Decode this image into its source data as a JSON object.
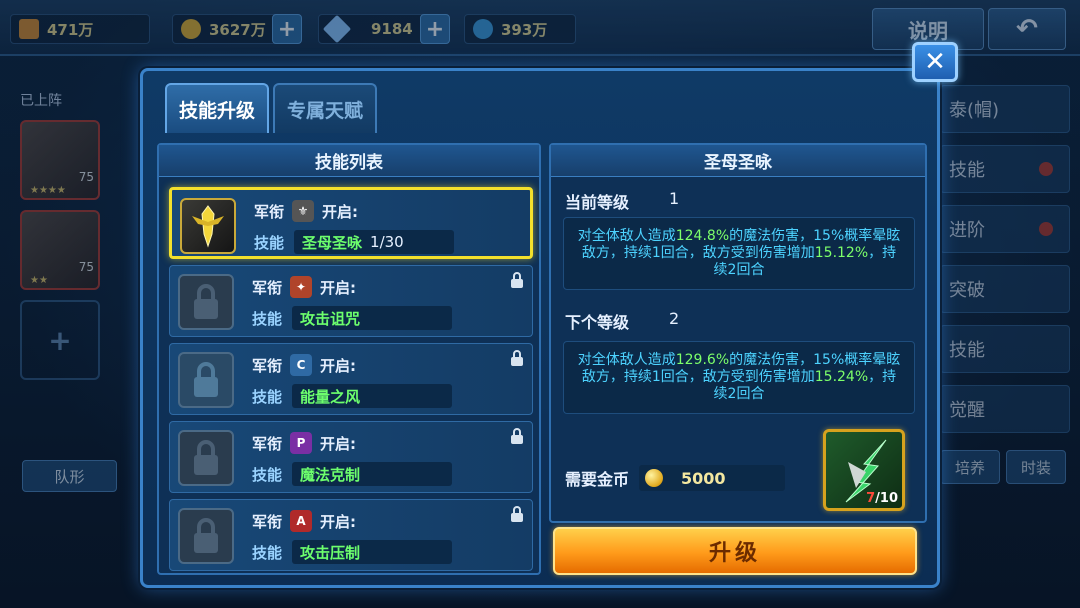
{
  "background": {
    "topbar": {
      "res1_value": "471万",
      "gold_value": "3627万",
      "gem_value": "9184",
      "energy_value": "393万",
      "help_label": "说明"
    },
    "left": {
      "deployed_label": "已上阵",
      "hero1_level": "75",
      "hero2_level": "75",
      "formation_label": "队形"
    },
    "right": {
      "items": [
        "泰(帽)",
        "技能",
        "进阶",
        "突破",
        "技能",
        "觉醒"
      ],
      "bottom": [
        "培养",
        "时装"
      ]
    }
  },
  "dialog": {
    "tabs": [
      {
        "label": "技能升级",
        "active": true
      },
      {
        "label": "专属天赋",
        "active": false
      }
    ],
    "skill_list": {
      "title": "技能列表",
      "rank_label": "军衔",
      "open_label": "开启:",
      "skill_label": "技能",
      "skills": [
        {
          "name": "圣母圣咏",
          "level": "1/30",
          "rank_icon": "wings-badge-icon",
          "rank_color": "#7a7a7a",
          "selected": true,
          "locked": false
        },
        {
          "name": "攻击诅咒",
          "level": "",
          "rank_icon": "star-badge-icon",
          "rank_color": "#b0442a",
          "selected": false,
          "locked": true
        },
        {
          "name": "能量之风",
          "level": "",
          "rank_icon": "c-badge-icon",
          "rank_color": "#2f6aa4",
          "selected": false,
          "locked": true
        },
        {
          "name": "魔法克制",
          "level": "",
          "rank_icon": "p-badge-icon",
          "rank_color": "#7a2fa4",
          "selected": false,
          "locked": true
        },
        {
          "name": "攻击压制",
          "level": "",
          "rank_icon": "a-badge-icon",
          "rank_color": "#b02a2a",
          "selected": false,
          "locked": true
        }
      ]
    },
    "detail": {
      "title": "圣母圣咏",
      "current_level_label": "当前等级",
      "current_level": "1",
      "current_desc_pre": "对全体敌人造成",
      "current_desc_pct": "124.8%",
      "current_desc_mid": "的魔法伤害，15%概率晕眩敌方，持续1回合，敌方受到伤害增加",
      "current_desc_pct2": "15.12%",
      "current_desc_post": "，持续2回合",
      "next_level_label": "下个等级",
      "next_level": "2",
      "next_desc_pre": "对全体敌人造成",
      "next_desc_pct": "129.6%",
      "next_desc_mid": "的魔法伤害，15%概率晕眩敌方，持续1回合，敌方受到伤害增加",
      "next_desc_pct2": "15.24%",
      "next_desc_post": "，持续2回合",
      "cost_label": "需要金币",
      "cost_value": "5000",
      "item_have": "7",
      "item_need": "/10"
    },
    "upgrade_label": "升级",
    "close_icon": "close-icon"
  },
  "colors": {
    "selected_border": "#f3e02c",
    "highlight_green": "#7dff6a",
    "desc_cyan": "#4dd3ff",
    "upgrade_orange": "#ff9a1a"
  }
}
